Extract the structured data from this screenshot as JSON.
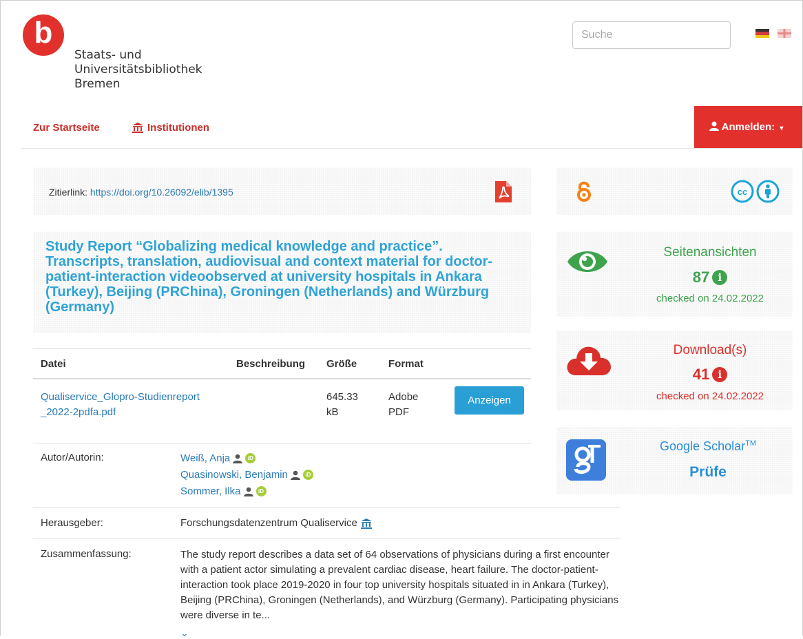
{
  "header": {
    "logo_letter": "b",
    "logo_lines": [
      "Staats- und",
      "Universitätsbibliothek",
      "Bremen"
    ],
    "search_placeholder": "Suche",
    "languages": [
      "de-flag-icon",
      "en-flag-icon"
    ]
  },
  "nav": {
    "home": "Zur Startseite",
    "institutions": "Institutionen",
    "login": "Anmelden:"
  },
  "citation": {
    "label": "Zitierlink:",
    "url": "https://doi.org/10.26092/elib/1395"
  },
  "title": "Study Report “Globalizing medical knowledge and practice”. Transcripts, translation, audiovisual and context material for doctor-patient-interaction videoobserved at university hospitals in Ankara (Turkey), Beijing (PRChina), Groningen (Netherlands) and Würzburg (Germany)",
  "files": {
    "headers": [
      "Datei",
      "Beschreibung",
      "Größe",
      "Format"
    ],
    "rows": [
      {
        "name_line1": "Qualiservice_Glopro-Studienreport",
        "name_line2": "_2022-2pdfa.pdf",
        "size_line1": "645.33",
        "size_line2": "kB",
        "format_line1": "Adobe",
        "format_line2": "PDF",
        "action": "Anzeigen"
      }
    ]
  },
  "metadata": {
    "author_label": "Autor/Autorin:",
    "authors": [
      "Weiß, Anja",
      "Quasinowski, Benjamin",
      "Sommer, Ilka"
    ],
    "publisher_label": "Herausgeber:",
    "publisher": "Forschungsdatenzentrum Qualiservice",
    "abstract_label": "Zusammenfassung:",
    "abstract": "The study report describes a data set of 64 observations of physicians during a first encounter with a patient actor simulating a prevalent cardiac disease, heart failure. The doctor-patient-interaction took place 2019-2020 in four top university hospitals situated in in Ankara (Turkey), Beijing (PRChina), Groningen (Netherlands), and Würzburg (Germany). Participating physicians were diverse in te..."
  },
  "sidebar": {
    "views": {
      "title": "Seitenansichten",
      "count": "87",
      "checked": "checked on 24.02.2022",
      "color": "#3fa34d"
    },
    "downloads": {
      "title": "Download(s)",
      "count": "41",
      "checked": "checked on 24.02.2022",
      "color": "#d9302c"
    },
    "scholar": {
      "title": "Google Scholar",
      "tm": "TM",
      "action": "Prüfe",
      "color": "#2a8ed6"
    }
  },
  "colors": {
    "brand_red": "#e2312d",
    "link_blue": "#2a7ab5",
    "title_blue": "#2fa3d6",
    "button_blue": "#2a9fd6",
    "open_access_orange": "#f68212",
    "cc_blue": "#1aa3d8"
  }
}
